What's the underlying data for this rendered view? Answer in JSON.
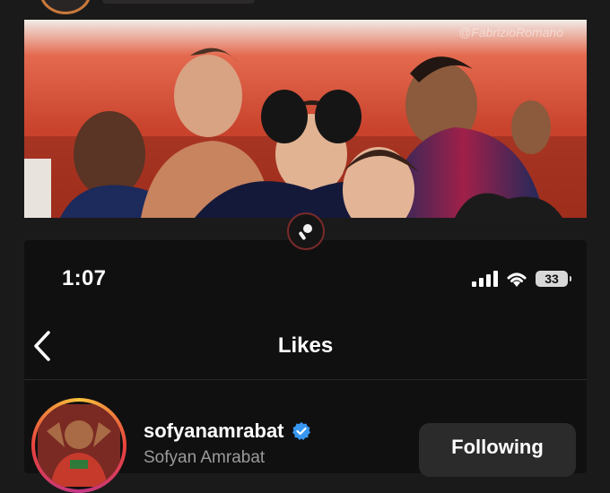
{
  "banner": {
    "watermark": "@FabrizioRomano"
  },
  "status_bar": {
    "time": "1:07",
    "battery": "33",
    "icons": [
      "cellular-signal-icon",
      "wifi-icon",
      "battery-icon"
    ]
  },
  "header": {
    "title": "Likes",
    "back_icon": "chevron-left-icon"
  },
  "likes_list": [
    {
      "username": "sofyanamrabat",
      "verified": true,
      "full_name": "Sofyan Amrabat",
      "action_label": "Following"
    }
  ],
  "colors": {
    "background": "#1b1a1a",
    "screen": "#111010",
    "verified": "#3897f0",
    "following_button": "#2c2b2b",
    "secondary_text": "#9a9a9a"
  }
}
